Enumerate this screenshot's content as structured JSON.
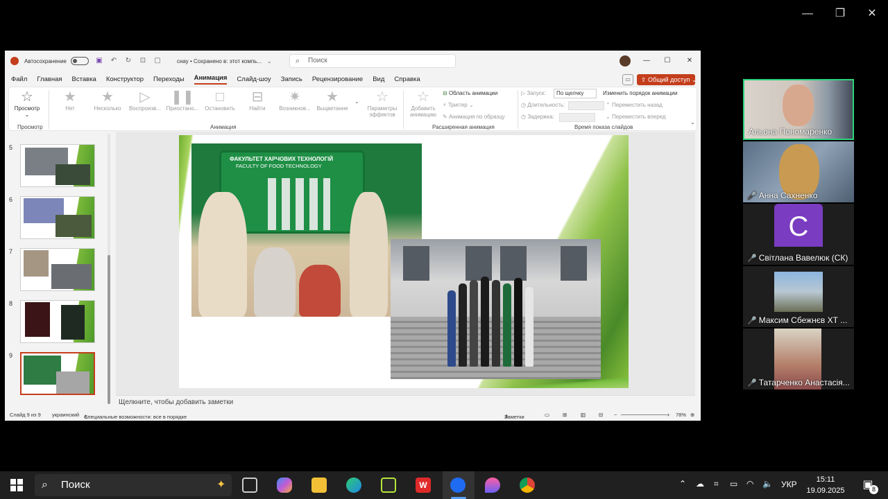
{
  "zoom_window": {
    "minimize": "—",
    "restore": "❐",
    "close": "✕"
  },
  "ppt": {
    "autosave_label": "Автосохранение",
    "doc_title": "cнау • Сохранено в: этот компь...",
    "search_placeholder": "Поиск",
    "menu": [
      "Файл",
      "Главная",
      "Вставка",
      "Конструктор",
      "Переходы",
      "Анимация",
      "Слайд-шоу",
      "Запись",
      "Рецензирование",
      "Вид",
      "Справка"
    ],
    "active_menu": "Анимация",
    "share_label": "Общий доступ",
    "ribbon": {
      "preview_label": "Просмотр",
      "preview_group": "Просмотр",
      "effects": [
        "Нет",
        "Несколько",
        "Воспроизв...",
        "Приостано...",
        "Остановить",
        "Найти",
        "Возникнов...",
        "Выцветание"
      ],
      "animation_group": "Анимация",
      "effect_params": "Параметры эффектов",
      "add_animation": "Добавить анимацию",
      "animation_area": "Область анимации",
      "trigger": "Триггер",
      "by_sample": "Анимация по образцу",
      "advanced_group": "Расширенная анимация",
      "start_label": "Запуск:",
      "start_value": "По щелчку",
      "duration_label": "Длительность:",
      "delay_label": "Задержка:",
      "timing_group": "Время показа слайдов",
      "reorder_title": "Изменить порядок анимации",
      "move_back": "Переместить назад",
      "move_forward": "Переместить вперед"
    },
    "slides": [
      {
        "num": "5"
      },
      {
        "num": "6"
      },
      {
        "num": "7"
      },
      {
        "num": "8"
      },
      {
        "num": "9"
      }
    ],
    "slide_content": {
      "board_title": "ФАКУЛЬТЕТ ХАРЧОВИХ ТЕХНОЛОГІЙ",
      "board_subtitle": "FACULTY OF FOOD TECHNOLOGY"
    },
    "notes_placeholder": "Щелкните, чтобы добавить заметки",
    "status": {
      "slide_info": "Слайд 9 из 9",
      "language": "украинский",
      "accessibility": "Специальные возможности: все в порядке",
      "notes_btn": "Заметки",
      "zoom": "78%"
    }
  },
  "participants": [
    {
      "name": "Альона Пономаренко",
      "muted": false,
      "active": true,
      "mic": ""
    },
    {
      "name": "Анна Сахненко",
      "muted": true,
      "active": false,
      "mic": "🎤"
    },
    {
      "name": "Світлана Вавелюк (СК)",
      "muted": true,
      "active": false,
      "initial": "C",
      "mic": "🎤"
    },
    {
      "name": "Максим Сбежнєв ХТ ...",
      "muted": true,
      "active": false,
      "mic": "🎤"
    },
    {
      "name": "Татарченко Анастасія...",
      "muted": true,
      "active": false,
      "mic": "🎤"
    }
  ],
  "taskbar": {
    "search_placeholder": "Поиск",
    "language": "УКР",
    "time": "15:11",
    "date": "19.09.2025",
    "notifications": "8"
  }
}
